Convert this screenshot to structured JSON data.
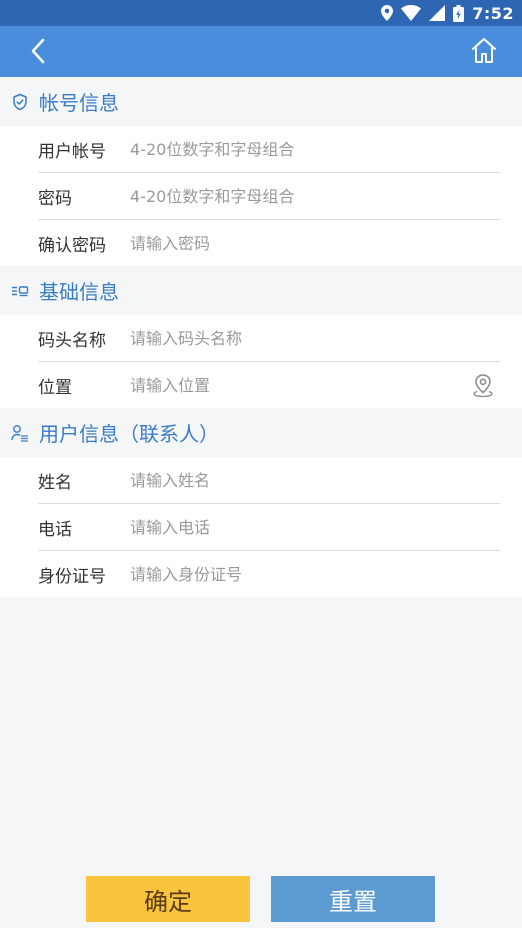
{
  "status_bar": {
    "time": "7:52"
  },
  "colors": {
    "app_bar": "#4a8ddc",
    "status_bar": "#2f66b4",
    "section_title": "#3a7cc8",
    "confirm_button": "#fbc43d",
    "reset_button": "#5b9bd1"
  },
  "app_bar": {
    "back_icon": "chevron-left-icon",
    "home_icon": "home-icon"
  },
  "sections": {
    "account": {
      "title": "帐号信息",
      "icon": "shield-icon",
      "fields": [
        {
          "label": "用户帐号",
          "placeholder": "4-20位数字和字母组合",
          "value": ""
        },
        {
          "label": "密码",
          "placeholder": "4-20位数字和字母组合",
          "value": ""
        },
        {
          "label": "确认密码",
          "placeholder": "请输入密码",
          "value": ""
        }
      ]
    },
    "basic": {
      "title": "基础信息",
      "icon": "list-icon",
      "fields": [
        {
          "label": "码头名称",
          "placeholder": "请输入码头名称",
          "value": ""
        },
        {
          "label": "位置",
          "placeholder": "请输入位置",
          "value": "",
          "icon": "location-pin-icon"
        }
      ]
    },
    "user": {
      "title": "用户信息（联系人）",
      "icon": "user-icon",
      "fields": [
        {
          "label": "姓名",
          "placeholder": "请输入姓名",
          "value": ""
        },
        {
          "label": "电话",
          "placeholder": "请输入电话",
          "value": ""
        },
        {
          "label": "身份证号",
          "placeholder": "请输入身份证号",
          "value": ""
        }
      ]
    }
  },
  "buttons": {
    "confirm": "确定",
    "reset": "重置"
  }
}
